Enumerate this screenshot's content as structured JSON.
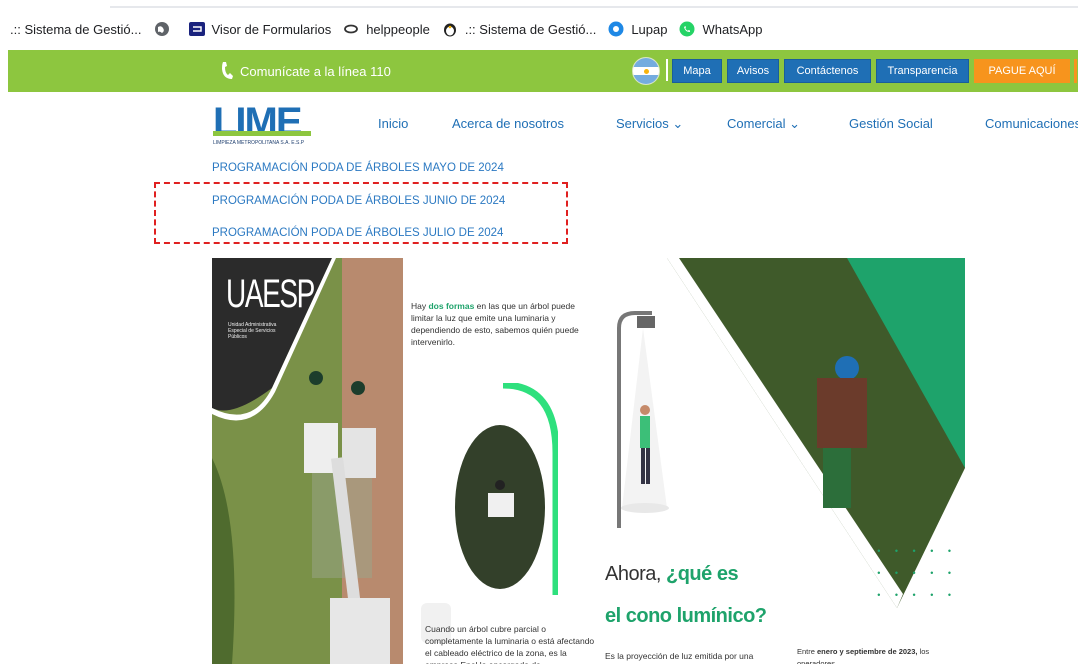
{
  "bookmarks": [
    {
      "label": ".:: Sistema de Gestió...",
      "icon": "none"
    },
    {
      "label": "",
      "icon": "globe-icon"
    },
    {
      "label": "Visor de Formularios",
      "icon": "form-icon"
    },
    {
      "label": "helppeople",
      "icon": "link-icon"
    },
    {
      "label": ".:: Sistema de Gestió...",
      "icon": "penguin-icon"
    },
    {
      "label": "Lupap",
      "icon": "lupap-icon"
    },
    {
      "label": "WhatsApp",
      "icon": "whatsapp-icon"
    }
  ],
  "topbar": {
    "phone_text": "Comunícate a la línea 110",
    "buttons": [
      "Mapa",
      "Avisos",
      "Contáctenos",
      "Transparencia"
    ],
    "pay_label": "PAGUE AQUÍ"
  },
  "logo": {
    "text": "LIME",
    "subtitle": "LIMPIEZA METROPOLITANA S.A. E.S.P"
  },
  "nav": {
    "items": [
      "Inicio",
      "Acerca de nosotros",
      "Servicios ⌄",
      "Comercial ⌄",
      "Gestión Social",
      "Comunicaciones"
    ]
  },
  "dropdown": {
    "links": [
      "PROGRAMACIÓN PODA DE ÁRBOLES MAYO DE 2024",
      "PROGRAMACIÓN PODA DE ÁRBOLES JUNIO DE 2024",
      "PROGRAMACIÓN PODA DE ÁRBOLES JULIO DE 2024"
    ]
  },
  "infographic": {
    "uaesp": "UAESP",
    "uaesp_sub": "Unidad Administrativa Especial de Servicios Públicos",
    "intro_pre": "Hay ",
    "intro_hl": "dos formas",
    "intro_post": " en las que un árbol puede limitar la luz que emite una luminaria y dependiendo de esto, sabemos quién puede intervenirlo.",
    "partial_text": "Cuando un árbol cubre parcial o completamente la luminaria o está afectando el cableado eléctrico de la zona, es la empresa Enel la encargada de",
    "question_line1": "Ahora, ",
    "question_hl": "¿qué es",
    "question_line2": "el cono lumínico?",
    "answer_text": "Es la proyección de luz emitida por una",
    "footer_pre": "Entre ",
    "footer_hl": "enero y septiembre de 2023,",
    "footer_post": " los operadores"
  },
  "colors": {
    "green_bar": "#8dc63f",
    "nav_button": "#1f6fb5",
    "pay_button": "#f7941d",
    "link": "#2b79c2",
    "highlight_border": "#e02020",
    "accent_green": "#1ea36b"
  }
}
